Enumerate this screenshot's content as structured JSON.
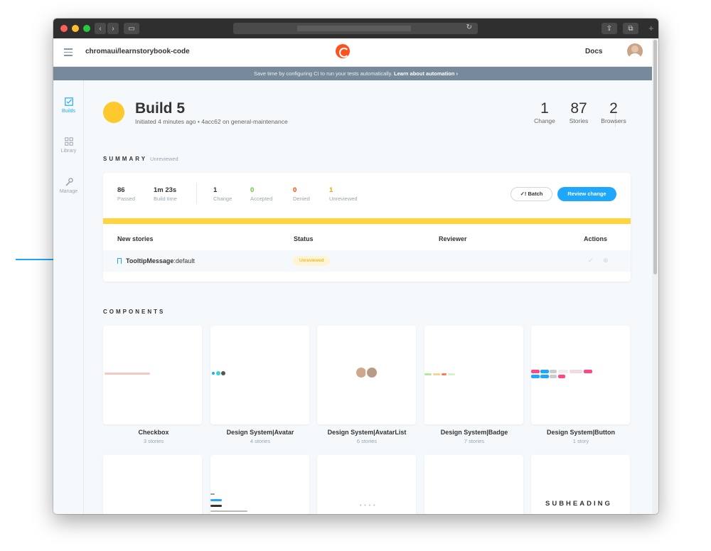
{
  "app": {
    "repo": "chromaui/learnstorybook-code",
    "docs_link": "Docs"
  },
  "banner": {
    "text": "Save time by configuring CI to run your tests automatically.",
    "link": "Learn about automation ›"
  },
  "sidebar": {
    "items": [
      {
        "label": "Builds",
        "icon": "checkbox-icon",
        "active": true
      },
      {
        "label": "Library",
        "icon": "grid-icon",
        "active": false
      },
      {
        "label": "Manage",
        "icon": "wrench-icon",
        "active": false
      }
    ]
  },
  "build": {
    "title": "Build 5",
    "subtitle": "Initiated 4 minutes ago • 4acc62 on general-maintenance",
    "status_color": "#ffc82c",
    "stats": [
      {
        "num": "1",
        "label": "Change"
      },
      {
        "num": "87",
        "label": "Stories"
      },
      {
        "num": "2",
        "label": "Browsers"
      }
    ]
  },
  "summary": {
    "heading": "SUMMARY",
    "state": "Unreviewed",
    "metrics": [
      {
        "value": "86",
        "label": "Passed",
        "color": "#333333"
      },
      {
        "value": "1m 23s",
        "label": "Build time",
        "color": "#333333"
      },
      {
        "value": "1",
        "label": "Change",
        "color": "#333333"
      },
      {
        "value": "0",
        "label": "Accepted",
        "color": "#66bf3c"
      },
      {
        "value": "0",
        "label": "Denied",
        "color": "#ff4400"
      },
      {
        "value": "1",
        "label": "Unreviewed",
        "color": "#e0a800"
      }
    ],
    "batch_button": "✓! Batch",
    "review_button": "Review change",
    "table": {
      "headers": [
        "New stories",
        "Status",
        "Reviewer",
        "Actions"
      ],
      "rows": [
        {
          "component": "TooltipMessage",
          "story": ":default",
          "status": "Unreviewed"
        }
      ]
    }
  },
  "components": {
    "heading": "COMPONENTS",
    "tiles": [
      {
        "name": "Checkbox",
        "stories": "3 stories"
      },
      {
        "name": "Design System|Avatar",
        "stories": "4 stories"
      },
      {
        "name": "Design System|AvatarList",
        "stories": "6 stories"
      },
      {
        "name": "Design System|Badge",
        "stories": "7 stories"
      },
      {
        "name": "Design System|Button",
        "stories": "1 story"
      }
    ],
    "row2_subheading": "SUBHEADING"
  },
  "colors": {
    "accent": "#1ea7fd",
    "warning": "#ffc82c",
    "brand": "#fc521f"
  }
}
